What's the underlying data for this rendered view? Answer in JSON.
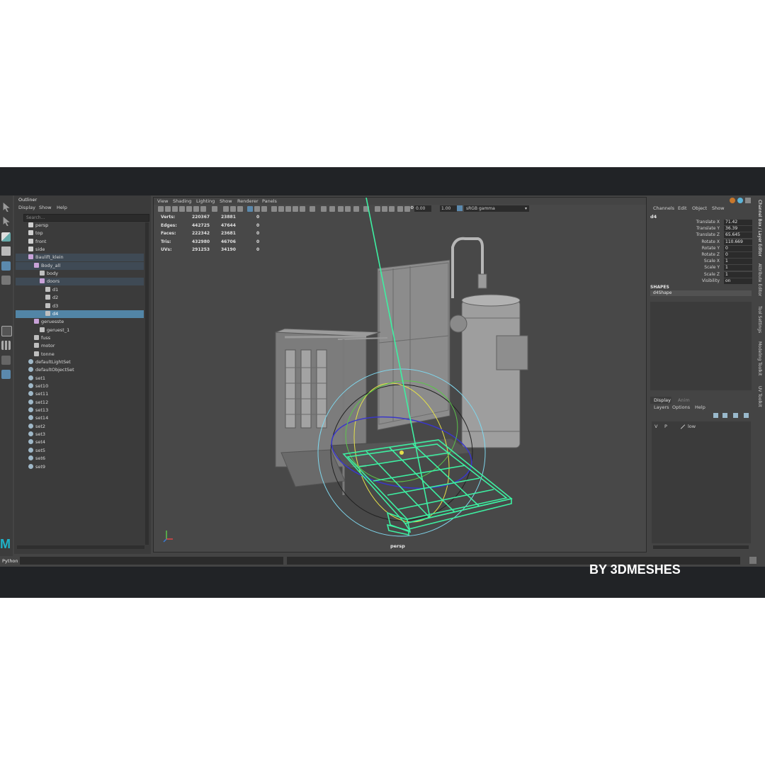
{
  "outliner": {
    "tab": "Outliner",
    "menus": [
      "Display",
      "Show",
      "Help"
    ],
    "search_placeholder": "Search...",
    "items": [
      {
        "label": "persp",
        "kind": "camera"
      },
      {
        "label": "top",
        "kind": "camera"
      },
      {
        "label": "front",
        "kind": "camera"
      },
      {
        "label": "side",
        "kind": "camera"
      },
      {
        "label": "Baulift_klein",
        "kind": "group"
      },
      {
        "label": "Body_all",
        "kind": "group"
      },
      {
        "label": "body",
        "kind": "mesh"
      },
      {
        "label": "doors",
        "kind": "group"
      },
      {
        "label": "d1",
        "kind": "mesh"
      },
      {
        "label": "d2",
        "kind": "mesh"
      },
      {
        "label": "d3",
        "kind": "mesh"
      },
      {
        "label": "d4",
        "kind": "mesh"
      },
      {
        "label": "geruesste",
        "kind": "group"
      },
      {
        "label": "geruest_1",
        "kind": "mesh"
      },
      {
        "label": "fuss",
        "kind": "mesh"
      },
      {
        "label": "motor",
        "kind": "mesh"
      },
      {
        "label": "tonne",
        "kind": "mesh"
      },
      {
        "label": "defaultLightSet",
        "kind": "set"
      },
      {
        "label": "defaultObjectSet",
        "kind": "set"
      },
      {
        "label": "set1",
        "kind": "set"
      },
      {
        "label": "set10",
        "kind": "set"
      },
      {
        "label": "set11",
        "kind": "set"
      },
      {
        "label": "set12",
        "kind": "set"
      },
      {
        "label": "set13",
        "kind": "set"
      },
      {
        "label": "set14",
        "kind": "set"
      },
      {
        "label": "set2",
        "kind": "set"
      },
      {
        "label": "set3",
        "kind": "set"
      },
      {
        "label": "set4",
        "kind": "set"
      },
      {
        "label": "set5",
        "kind": "set"
      },
      {
        "label": "set6",
        "kind": "set"
      },
      {
        "label": "set9",
        "kind": "set"
      }
    ]
  },
  "viewport": {
    "menus": [
      "View",
      "Shading",
      "Lighting",
      "Show",
      "Renderer",
      "Panels"
    ],
    "exposure": "0.00",
    "gamma": "1.00",
    "color_space": "sRGB gamma",
    "camera_label": "persp",
    "hud": [
      {
        "label": "Verts:",
        "v1": "220367",
        "v2": "23881",
        "v3": "0"
      },
      {
        "label": "Edges:",
        "v1": "442725",
        "v2": "47644",
        "v3": "0"
      },
      {
        "label": "Faces:",
        "v1": "222342",
        "v2": "23681",
        "v3": "0"
      },
      {
        "label": "Tris:",
        "v1": "432980",
        "v2": "46706",
        "v3": "0"
      },
      {
        "label": "UVs:",
        "v1": "291253",
        "v2": "34190",
        "v3": "0"
      }
    ]
  },
  "channel_box": {
    "menus": [
      "Channels",
      "Edit",
      "Object",
      "Show"
    ],
    "object": "d4",
    "attributes": [
      {
        "label": "Translate X",
        "value": "71.42"
      },
      {
        "label": "Translate Y",
        "value": "36.39"
      },
      {
        "label": "Translate Z",
        "value": "65.645"
      },
      {
        "label": "Rotate X",
        "value": "110.669"
      },
      {
        "label": "Rotate Y",
        "value": "0"
      },
      {
        "label": "Rotate Z",
        "value": "0"
      },
      {
        "label": "Scale X",
        "value": "1"
      },
      {
        "label": "Scale Y",
        "value": "1"
      },
      {
        "label": "Scale Z",
        "value": "1"
      },
      {
        "label": "Visibility",
        "value": "on"
      }
    ],
    "shapes_header": "SHAPES",
    "shape_name": "d4Shape",
    "side_tabs": [
      "Channel Box / Layer Editor",
      "Attribute Editor",
      "Tool Settings",
      "Modeling Toolkit",
      "UV Toolkit"
    ]
  },
  "layer_editor": {
    "tabs": [
      "Display",
      "Anim"
    ],
    "menus": [
      "Layers",
      "Options",
      "Help"
    ],
    "layer": {
      "v": "V",
      "p": "P",
      "name": "low"
    }
  },
  "command_line": {
    "label": "Python"
  },
  "watermark": "BY 3DMESHES",
  "colors": {
    "selection": "#5285a6",
    "wireframe_selected": "#3df0a2",
    "background": "#212326"
  }
}
